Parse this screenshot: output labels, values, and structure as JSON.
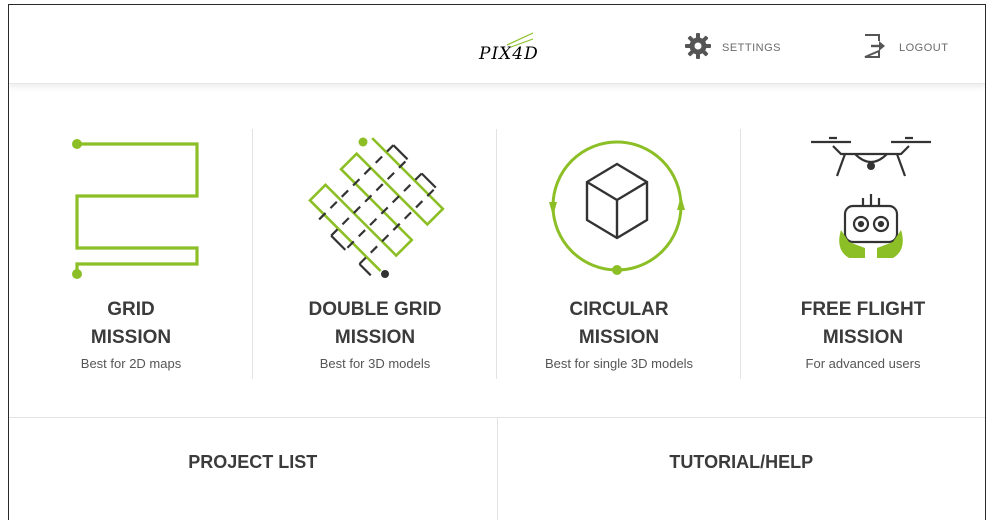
{
  "header": {
    "logo_text": "PIX4D",
    "settings_label": "SETTINGS",
    "logout_label": "LOGOUT"
  },
  "missions": [
    {
      "title_line1": "GRID",
      "title_line2": "MISSION",
      "subtitle": "Best for 2D maps",
      "icon": "grid-path-icon"
    },
    {
      "title_line1": "DOUBLE GRID",
      "title_line2": "MISSION",
      "subtitle": "Best for 3D models",
      "icon": "double-grid-path-icon"
    },
    {
      "title_line1": "CIRCULAR",
      "title_line2": "MISSION",
      "subtitle": "Best for single 3D models",
      "icon": "circular-path-icon"
    },
    {
      "title_line1": "FREE FLIGHT",
      "title_line2": "MISSION",
      "subtitle": "For advanced users",
      "icon": "drone-controller-icon"
    }
  ],
  "bottom": {
    "project_list_label": "PROJECT LIST",
    "tutorial_label": "TUTORIAL/HELP"
  },
  "colors": {
    "accent_green": "#8cbf26",
    "dark_line": "#333333",
    "text": "#3b3b3b"
  }
}
